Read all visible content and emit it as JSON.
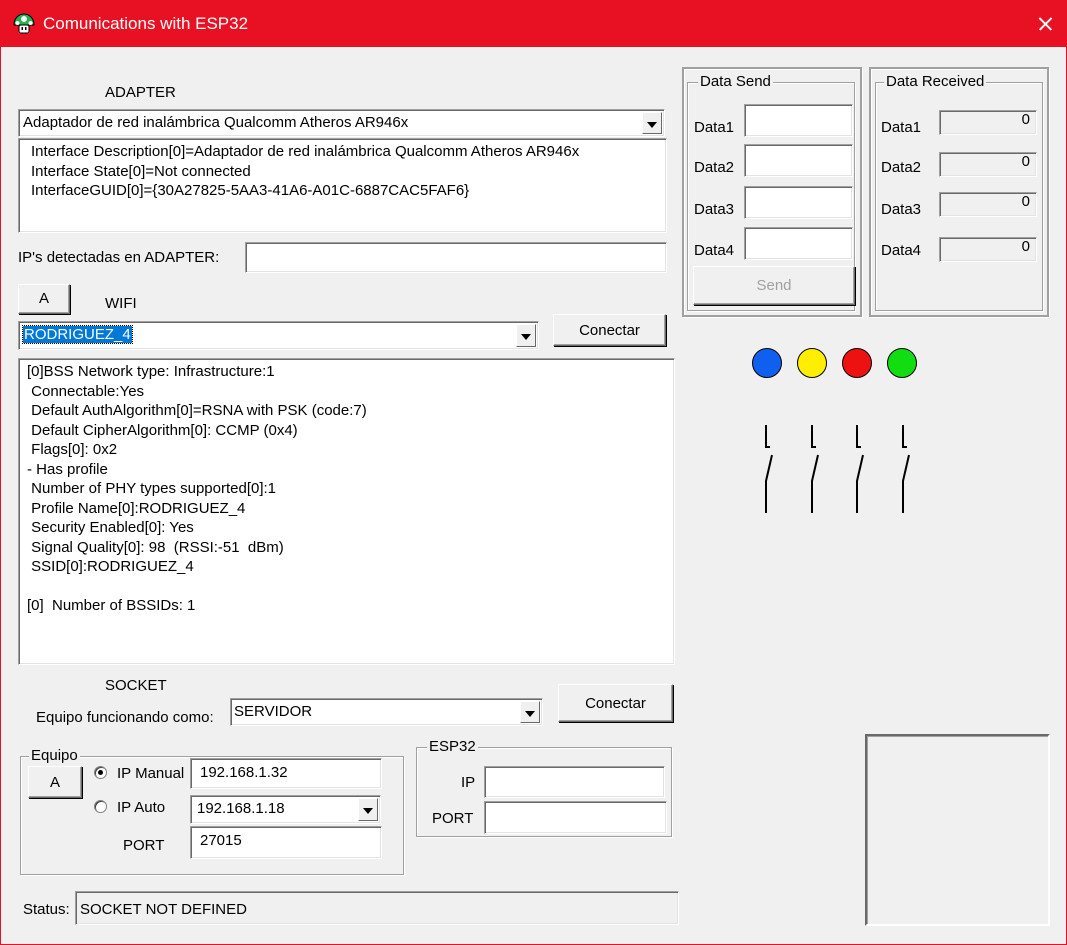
{
  "window": {
    "title": "Comunications with ESP32"
  },
  "adapter": {
    "label": "ADAPTER",
    "selected": "Adaptador de red inalámbrica Qualcomm Atheros AR946x",
    "info": "Interface Description[0]=Adaptador de red inalámbrica Qualcomm Atheros AR946x\nInterface State[0]=Not connected\nInterfaceGUID[0]={30A27825-5AA3-41A6-A01C-6887CAC5FAF6}",
    "ips_label": "IP's detectadas en ADAPTER:",
    "ips_value": ""
  },
  "wifi": {
    "a_button": "A",
    "label": "WIFI",
    "selected": "RODRIGUEZ_4",
    "connect_label": "Conectar",
    "info": "[0]BSS Network type: Infrastructure:1\n Connectable:Yes\n Default AuthAlgorithm[0]=RSNA with PSK (code:7)\n Default CipherAlgorithm[0]: CCMP (0x4)\n Flags[0]: 0x2\n- Has profile\n Number of PHY types supported[0]:1\n Profile Name[0]:RODRIGUEZ_4\n Security Enabled[0]: Yes\n Signal Quality[0]: 98  (RSSI:-51  dBm)\n SSID[0]:RODRIGUEZ_4\n\n[0]  Number of BSSIDs: 1"
  },
  "socket": {
    "label": "SOCKET",
    "mode_label": "Equipo funcionando como:",
    "mode_value": "SERVIDOR",
    "connect_label": "Conectar"
  },
  "equipo": {
    "title": "Equipo",
    "a_button": "A",
    "ip_manual_label": "IP Manual",
    "ip_manual_value": "192.168.1.32",
    "ip_auto_label": "IP Auto",
    "ip_auto_value": "192.168.1.18",
    "port_label": "PORT",
    "port_value": "27015",
    "ip_manual_checked": true
  },
  "esp32": {
    "title": "ESP32",
    "ip_label": "IP",
    "ip_value": "",
    "port_label": "PORT",
    "port_value": ""
  },
  "status": {
    "label": "Status:",
    "value": "SOCKET NOT DEFINED"
  },
  "data_send": {
    "title": "Data Send",
    "rows": [
      {
        "label": "Data1",
        "value": ""
      },
      {
        "label": "Data2",
        "value": ""
      },
      {
        "label": "Data3",
        "value": ""
      },
      {
        "label": "Data4",
        "value": ""
      }
    ],
    "send_label": "Send"
  },
  "data_received": {
    "title": "Data Received",
    "rows": [
      {
        "label": "Data1",
        "value": "0"
      },
      {
        "label": "Data2",
        "value": "0"
      },
      {
        "label": "Data3",
        "value": "0"
      },
      {
        "label": "Data4",
        "value": "0"
      }
    ]
  },
  "leds": [
    {
      "name": "blue-led",
      "color": "#1060f0"
    },
    {
      "name": "yellow-led",
      "color": "#ffee00"
    },
    {
      "name": "red-led",
      "color": "#ee1111"
    },
    {
      "name": "green-led",
      "color": "#11dd11"
    }
  ],
  "icons": {
    "app": "mushroom-icon",
    "close": "close-icon",
    "switch": "switch-icon"
  }
}
